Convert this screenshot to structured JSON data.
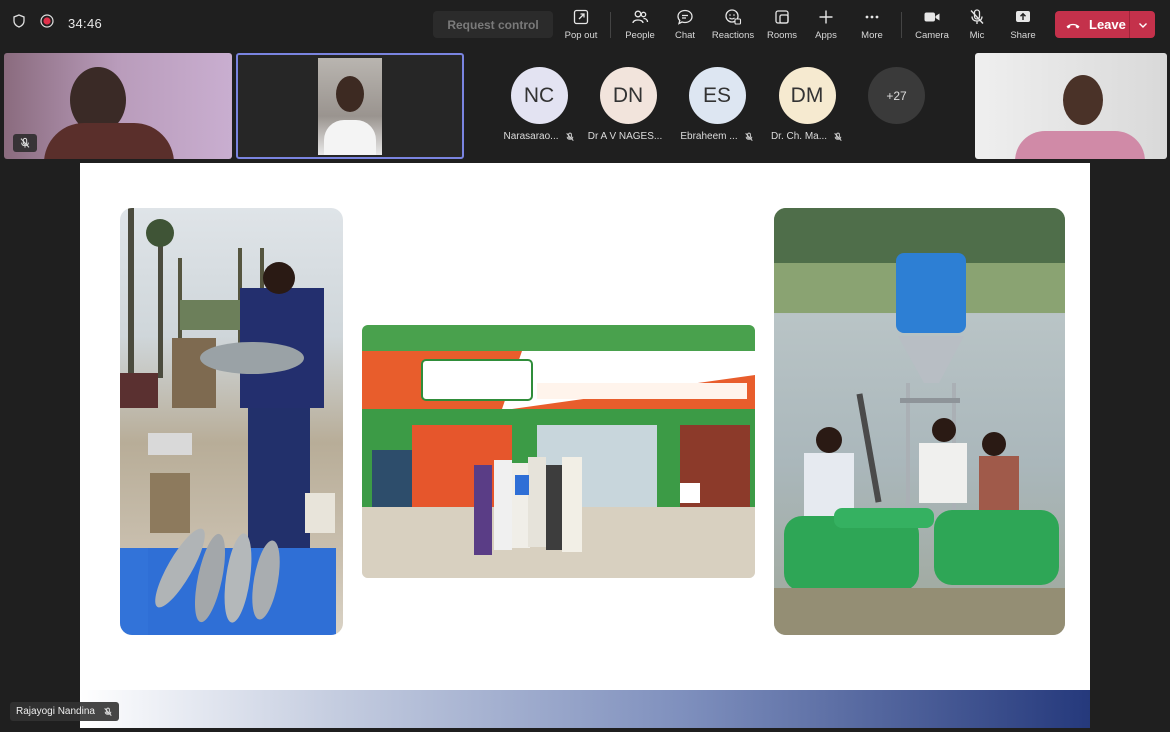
{
  "meeting": {
    "timer": "34:46",
    "request_control_label": "Request control"
  },
  "toolbar": {
    "items": [
      {
        "label": "Pop out",
        "icon": "pop-out-icon"
      },
      {
        "label": "People",
        "icon": "people-icon"
      },
      {
        "label": "Chat",
        "icon": "chat-icon"
      },
      {
        "label": "Reactions",
        "icon": "reactions-icon"
      },
      {
        "label": "Rooms",
        "icon": "rooms-icon"
      },
      {
        "label": "Apps",
        "icon": "apps-icon"
      },
      {
        "label": "More",
        "icon": "more-icon"
      },
      {
        "label": "Camera",
        "icon": "camera-icon"
      },
      {
        "label": "Mic",
        "icon": "mic-muted-icon"
      },
      {
        "label": "Share",
        "icon": "share-icon"
      }
    ],
    "leave_label": "Leave"
  },
  "participants": {
    "avatars": [
      {
        "initials": "NC",
        "name": "Narasarao...",
        "color": "#e3e3f2"
      },
      {
        "initials": "DN",
        "name": "Dr A V NAGES...",
        "color": "#f2e4dc"
      },
      {
        "initials": "ES",
        "name": "Ebraheem ...",
        "color": "#dde6f2"
      },
      {
        "initials": "DM",
        "name": "Dr. Ch. Ma...",
        "color": "#f6ead0"
      }
    ],
    "overflow_count": "+27"
  },
  "presenter": {
    "name": "Rajayogi Nandina"
  },
  "colors": {
    "leave": "#c4314b",
    "active_border": "#7a84e0"
  }
}
